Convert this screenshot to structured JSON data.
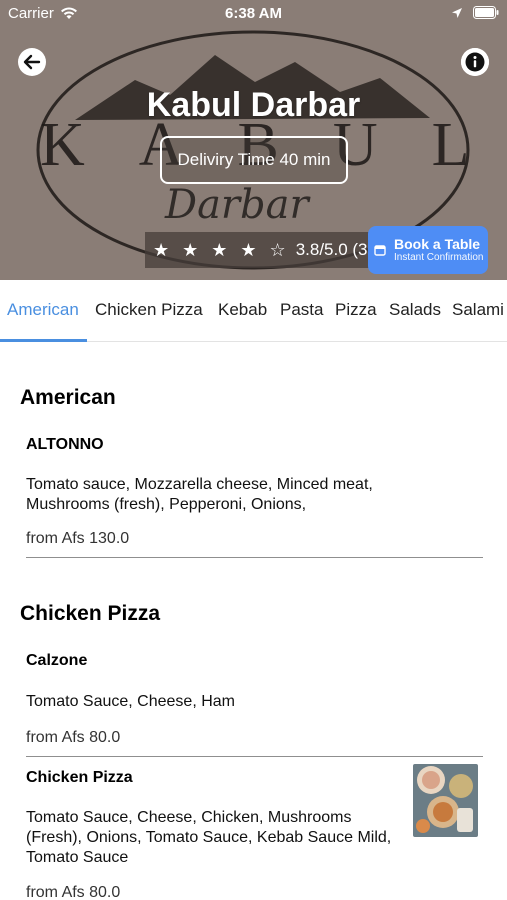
{
  "status_bar": {
    "carrier": "Carrier",
    "time": "6:38 AM"
  },
  "header": {
    "title": "Kabul Darbar",
    "delivery": "Deliviry Time 40 min",
    "rating": {
      "stars": "★ ★ ★ ★ ☆",
      "text": "3.8/5.0 (32)",
      "value": 3.8,
      "max": 5,
      "count": 32
    },
    "book": {
      "label": "Book a Table",
      "sub": "Instant Confirmation"
    },
    "logo_text": {
      "main": "KABUL",
      "script": "Darbar"
    },
    "colors": {
      "header_bg": "#8a7d76",
      "accent": "#4a8fe0",
      "book_bg": "#4e8df5"
    }
  },
  "tabs": [
    {
      "label": "American",
      "active": true
    },
    {
      "label": "Chicken Pizza"
    },
    {
      "label": "Kebab"
    },
    {
      "label": "Pasta"
    },
    {
      "label": "Pizza"
    },
    {
      "label": "Salads"
    },
    {
      "label": "Salami"
    }
  ],
  "sections": [
    {
      "title": "American",
      "items": [
        {
          "name": "ALTONNO",
          "desc": "Tomato sauce, Mozzarella cheese, Minced meat, Mushrooms (fresh), Pepperoni, Onions,",
          "price": "from Afs 130.0"
        }
      ]
    },
    {
      "title": "Chicken Pizza",
      "items": [
        {
          "name": "Calzone",
          "desc": "Tomato Sauce, Cheese, Ham",
          "price": "from Afs 80.0"
        },
        {
          "name": "Chicken Pizza",
          "desc": "Tomato Sauce, Cheese, Chicken, Mushrooms (Fresh), Onions, Tomato Sauce, Kebab Sauce Mild, Tomato Sauce",
          "price": "from Afs 80.0",
          "image": "food-photo"
        }
      ]
    }
  ]
}
